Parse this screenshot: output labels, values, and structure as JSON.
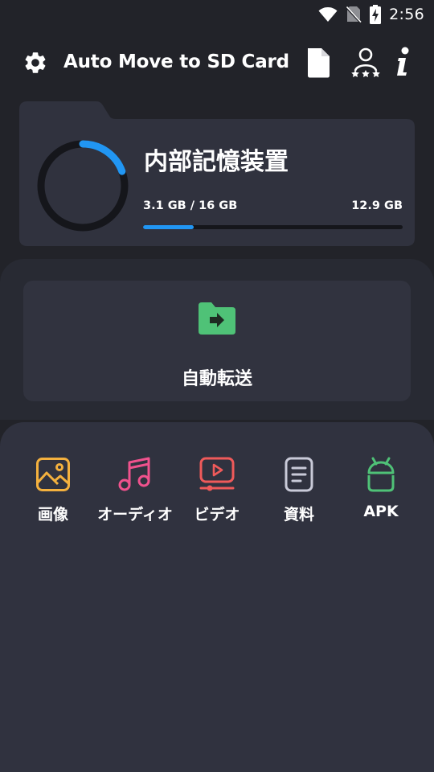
{
  "status_bar": {
    "time": "2:56",
    "icons": [
      "wifi-icon",
      "no-sim-icon",
      "battery-charging-icon"
    ]
  },
  "app_bar": {
    "title": "Auto Move to SD Card",
    "icons": [
      "gear-icon",
      "document-icon",
      "rate-stars-icon",
      "info-icon"
    ]
  },
  "storage": {
    "name": "内部記憶装置",
    "used_label": "3.1 GB / 16 GB",
    "free_label": "12.9 GB",
    "used_fraction": 0.194,
    "accent_color": "#2196f3"
  },
  "auto_transfer": {
    "label": "自動転送",
    "icon": "folder-move-icon",
    "icon_color": "#4fc277"
  },
  "categories": [
    {
      "label": "画像",
      "icon": "image-icon",
      "color": "#f4b13e"
    },
    {
      "label": "オーディオ",
      "icon": "music-icon",
      "color": "#f0528d"
    },
    {
      "label": "ビデオ",
      "icon": "video-icon",
      "color": "#ef5a5a"
    },
    {
      "label": "資料",
      "icon": "document-text-icon",
      "color": "#c9cad8"
    },
    {
      "label": "APK",
      "icon": "android-icon",
      "color": "#4fc277"
    }
  ]
}
